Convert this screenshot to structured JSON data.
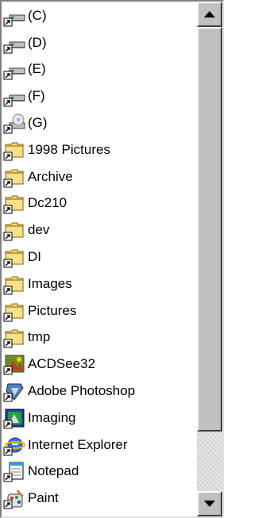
{
  "listbox": {
    "items": [
      {
        "label": "(C)",
        "icon": "network-drive-icon"
      },
      {
        "label": "(D)",
        "icon": "network-drive-icon"
      },
      {
        "label": "(E)",
        "icon": "network-drive-icon"
      },
      {
        "label": "(F)",
        "icon": "network-drive-icon"
      },
      {
        "label": "(G)",
        "icon": "cd-drive-icon"
      },
      {
        "label": "1998 Pictures",
        "icon": "folder-shortcut-icon"
      },
      {
        "label": "Archive",
        "icon": "folder-shortcut-icon"
      },
      {
        "label": "Dc210",
        "icon": "folder-shortcut-icon"
      },
      {
        "label": "dev",
        "icon": "folder-shortcut-icon"
      },
      {
        "label": "DI",
        "icon": "folder-shortcut-icon"
      },
      {
        "label": "Images",
        "icon": "folder-shortcut-icon"
      },
      {
        "label": "Pictures",
        "icon": "folder-shortcut-icon"
      },
      {
        "label": "tmp",
        "icon": "folder-shortcut-icon"
      },
      {
        "label": "ACDSee32",
        "icon": "acdsee-icon"
      },
      {
        "label": "Adobe Photoshop",
        "icon": "photoshop-icon"
      },
      {
        "label": "Imaging",
        "icon": "imaging-icon"
      },
      {
        "label": "Internet Explorer",
        "icon": "internet-explorer-icon"
      },
      {
        "label": "Notepad",
        "icon": "notepad-icon"
      },
      {
        "label": "Paint",
        "icon": "paint-icon"
      }
    ]
  },
  "scrollbar": {
    "up_icon": "scroll-up-arrow-icon",
    "down_icon": "scroll-down-arrow-icon"
  },
  "colors": {
    "folder": "#f6e08a",
    "window_face": "#c0c0c0"
  }
}
